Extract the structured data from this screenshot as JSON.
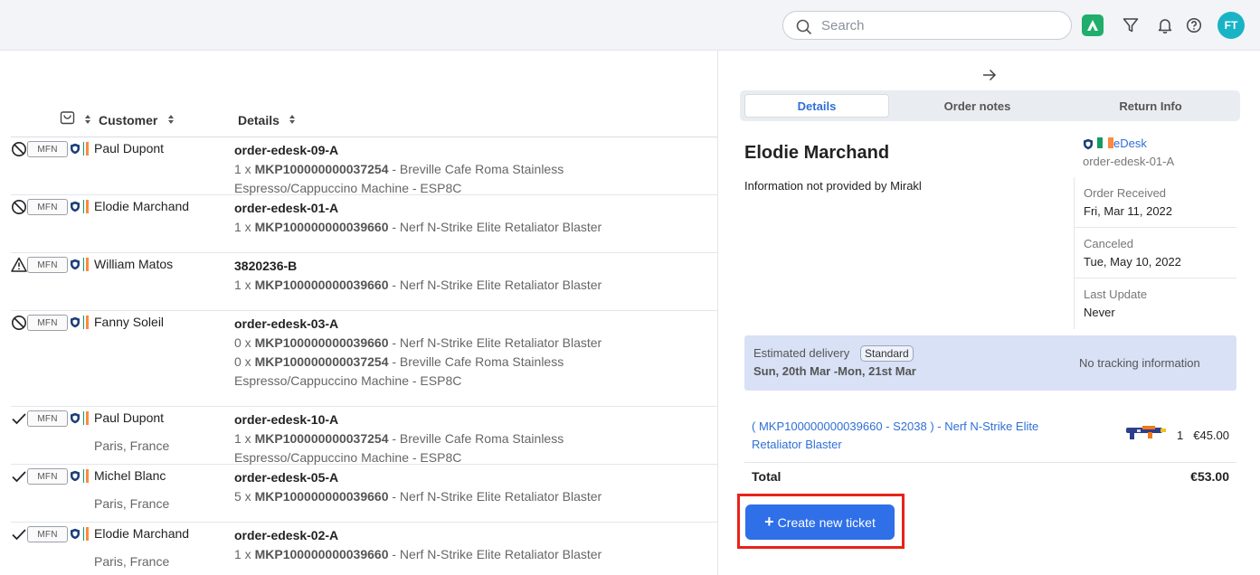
{
  "topbar": {
    "search_placeholder": "Search",
    "icons": [
      "search-icon",
      "app-badge-icon",
      "filter-icon",
      "bell-icon",
      "help-icon"
    ],
    "avatar_initials": "FT",
    "avatar_color": "#19b3c6"
  },
  "list": {
    "headers": {
      "customer": "Customer",
      "details": "Details"
    },
    "rows": [
      {
        "status_icon": "blocked-icon",
        "badge": "MFN",
        "customer": "Paul Dupont",
        "location": "",
        "order_id": "order-edesk-09-A",
        "lines": [
          {
            "qty": "1 x",
            "sku": "MKP100000000037254",
            "desc": "- Breville Cafe Roma Stainless Espresso/Cappuccino Machine - ESP8C"
          }
        ]
      },
      {
        "status_icon": "blocked-icon",
        "badge": "MFN",
        "customer": "Elodie Marchand",
        "location": "",
        "order_id": "order-edesk-01-A",
        "lines": [
          {
            "qty": "1 x",
            "sku": "MKP100000000039660",
            "desc": "- Nerf N-Strike Elite Retaliator Blaster"
          }
        ]
      },
      {
        "status_icon": "warning-icon",
        "badge": "MFN",
        "customer": "William Matos",
        "location": "",
        "order_id": "3820236-B",
        "lines": [
          {
            "qty": "1 x",
            "sku": "MKP100000000039660",
            "desc": "- Nerf N-Strike Elite Retaliator Blaster"
          }
        ]
      },
      {
        "status_icon": "blocked-icon",
        "badge": "MFN",
        "customer": "Fanny Soleil",
        "location": "",
        "order_id": "order-edesk-03-A",
        "lines": [
          {
            "qty": "0 x",
            "sku": "MKP100000000039660",
            "desc": "- Nerf N-Strike Elite Retaliator Blaster"
          },
          {
            "qty": "0 x",
            "sku": "MKP100000000037254",
            "desc": "- Breville Cafe Roma Stainless Espresso/Cappuccino Machine - ESP8C"
          }
        ]
      },
      {
        "status_icon": "check-icon",
        "badge": "MFN",
        "customer": "Paul Dupont",
        "location": "Paris, France",
        "order_id": "order-edesk-10-A",
        "lines": [
          {
            "qty": "1 x",
            "sku": "MKP100000000037254",
            "desc": "- Breville Cafe Roma Stainless Espresso/Cappuccino Machine - ESP8C"
          }
        ]
      },
      {
        "status_icon": "check-icon",
        "badge": "MFN",
        "customer": "Michel Blanc",
        "location": "Paris, France",
        "order_id": "order-edesk-05-A",
        "lines": [
          {
            "qty": "5 x",
            "sku": "MKP100000000039660",
            "desc": "- Nerf N-Strike Elite Retaliator Blaster"
          }
        ]
      },
      {
        "status_icon": "check-icon",
        "badge": "MFN",
        "customer": "Elodie Marchand",
        "location": "Paris, France",
        "order_id": "order-edesk-02-A",
        "lines": [
          {
            "qty": "1 x",
            "sku": "MKP100000000039660",
            "desc": "- Nerf N-Strike Elite Retaliator Blaster"
          }
        ]
      }
    ]
  },
  "panel": {
    "tabs": [
      "Details",
      "Order notes",
      "Return Info"
    ],
    "active_tab": "Details",
    "customer_name": "Elodie Marchand",
    "info_text": "Information not provided by Mirakl",
    "channel": "eDesk",
    "order_id": "order-edesk-01-A",
    "dates": [
      {
        "label": "Order Received",
        "value": "Fri, Mar 11, 2022"
      },
      {
        "label": "Canceled",
        "value": "Tue, May 10, 2022"
      },
      {
        "label": "Last Update",
        "value": "Never"
      }
    ],
    "delivery": {
      "label": "Estimated delivery",
      "badge": "Standard",
      "dates": "Sun, 20th Mar -Mon, 21st Mar",
      "tracking": "No tracking information"
    },
    "item": {
      "link": "( MKP100000000039660 - S2038 ) - Nerf N-Strike Elite Retaliator Blaster",
      "qty": "1",
      "price": "€45.00"
    },
    "total_label": "Total",
    "total_value": "€53.00",
    "create_button": "Create new ticket"
  },
  "colors": {
    "accent": "#2f6fe8",
    "link": "#2f6fd6",
    "highlight_border": "#e8231a",
    "delivery_bg": "#d8e1f5",
    "flag_ie": [
      "#169b62",
      "#ffffff",
      "#ff883e"
    ]
  }
}
